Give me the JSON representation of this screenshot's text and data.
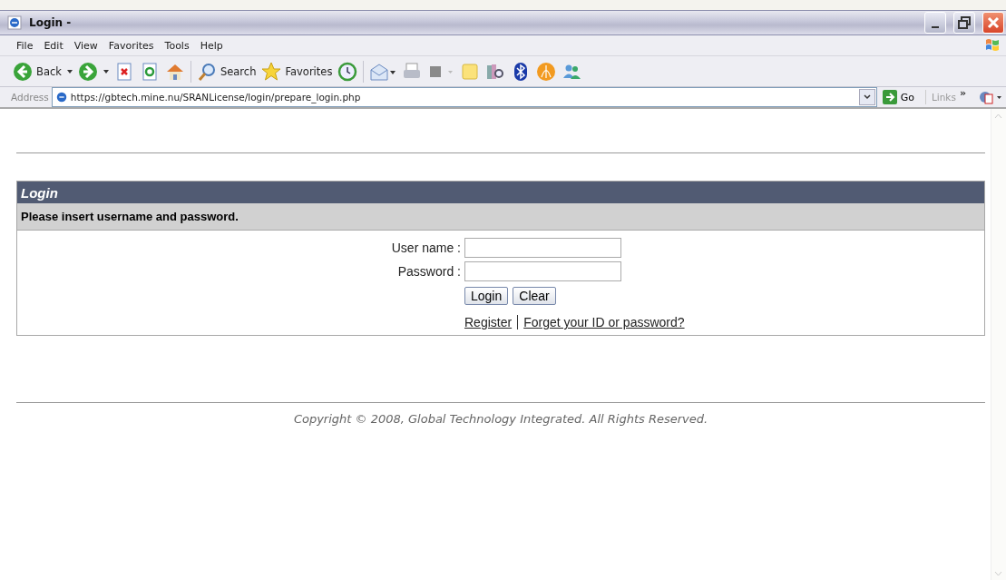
{
  "window": {
    "title": "Login -"
  },
  "menu": [
    "File",
    "Edit",
    "View",
    "Favorites",
    "Tools",
    "Help"
  ],
  "toolbar": [
    {
      "kind": "back",
      "label": "Back"
    },
    {
      "kind": "forward"
    },
    {
      "kind": "stop"
    },
    {
      "kind": "refresh"
    },
    {
      "kind": "home"
    },
    {
      "kind": "search",
      "label": "Search"
    },
    {
      "kind": "favorites",
      "label": "Favorites"
    },
    {
      "kind": "history"
    },
    {
      "kind": "mail"
    },
    {
      "kind": "print"
    },
    {
      "kind": "edit"
    },
    {
      "kind": "note"
    },
    {
      "kind": "research"
    },
    {
      "kind": "bluetooth"
    },
    {
      "kind": "orb"
    },
    {
      "kind": "messenger"
    }
  ],
  "address": {
    "label": "Address",
    "url": "https://gbtech.mine.nu/SRANLicense/login/prepare_login.php",
    "go": "Go",
    "links": "Links",
    "chevron": "»"
  },
  "panel": {
    "title": "Login",
    "instruction": "Please insert username and password.",
    "fields": [
      {
        "label": "User name :"
      },
      {
        "label": "Password :"
      }
    ],
    "buttons": [
      "Login",
      "Clear"
    ],
    "links": [
      "Register",
      "Forget your ID or password?"
    ]
  },
  "footer": {
    "copyright": "Copyright © 2008, Global Technology Integrated. All Rights Reserved."
  }
}
